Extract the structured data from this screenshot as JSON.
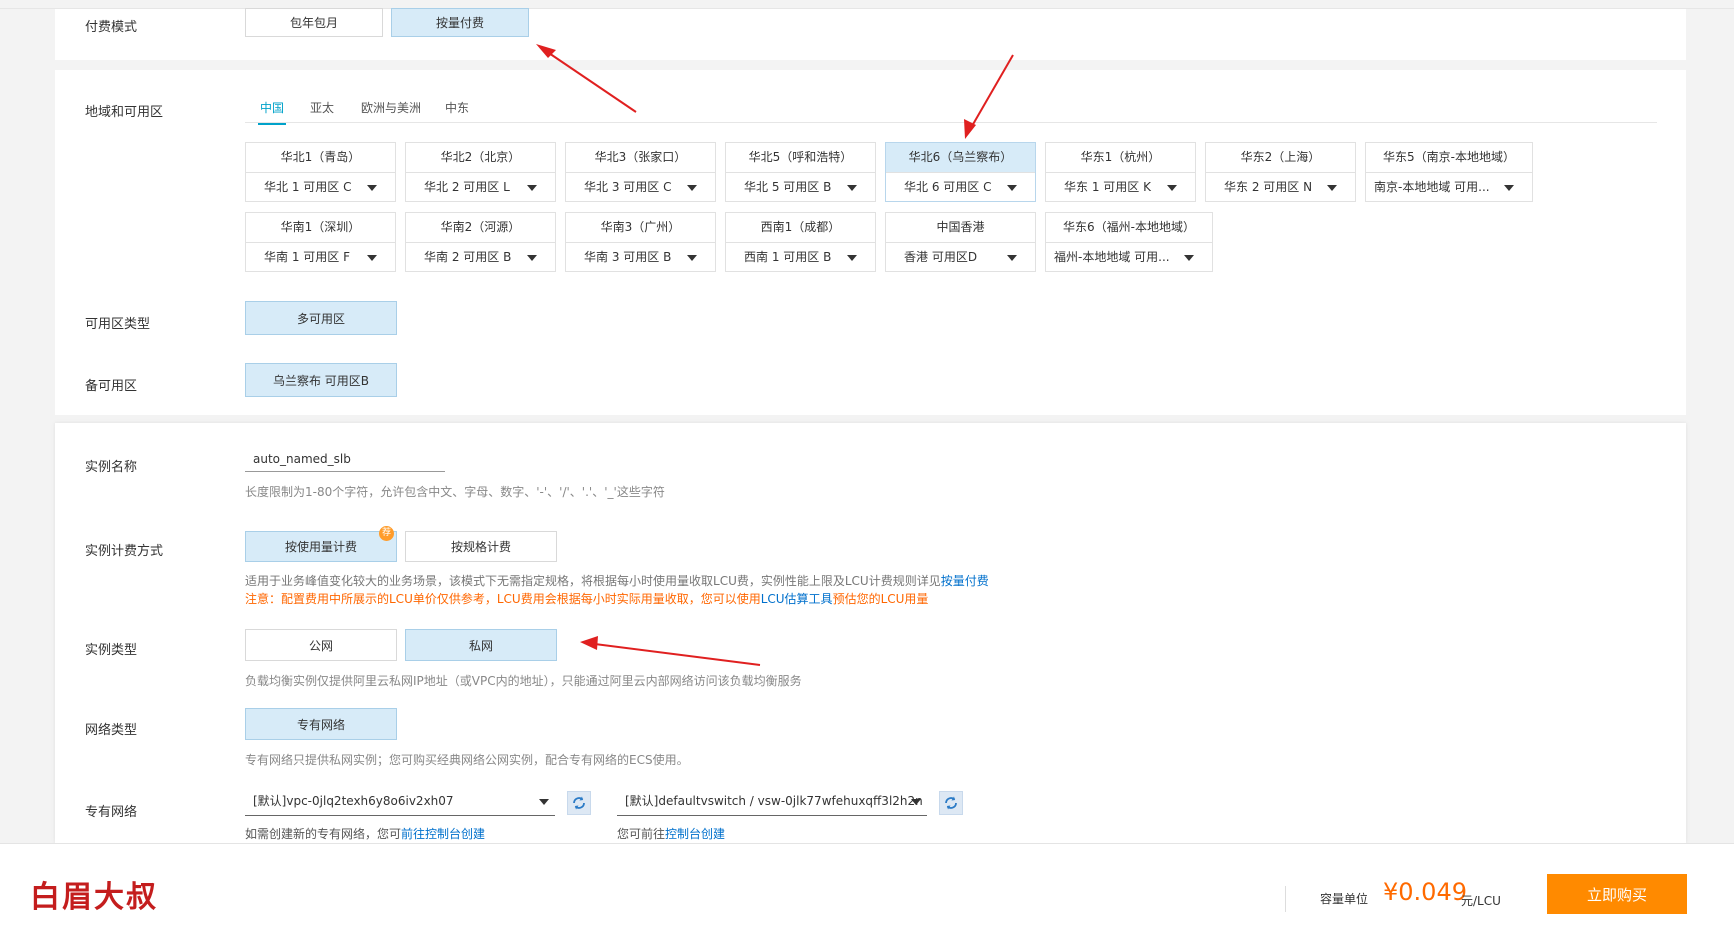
{
  "billing_mode": {
    "label": "付费模式",
    "options": [
      "包年包月",
      "按量付费"
    ],
    "selected": "按量付费"
  },
  "region": {
    "label": "地域和可用区",
    "tabs": [
      "中国",
      "亚太",
      "欧洲与美洲",
      "中东"
    ],
    "active_tab": "中国",
    "zones": [
      {
        "title": "华北1（青岛）",
        "zone": "华北 1 可用区 C"
      },
      {
        "title": "华北2（北京）",
        "zone": "华北 2 可用区 L"
      },
      {
        "title": "华北3（张家口）",
        "zone": "华北 3 可用区 C"
      },
      {
        "title": "华北5（呼和浩特）",
        "zone": "华北 5 可用区 B"
      },
      {
        "title": "华北6（乌兰察布）",
        "zone": "华北 6 可用区 C"
      },
      {
        "title": "华东1（杭州）",
        "zone": "华东 1 可用区 K"
      },
      {
        "title": "华东2（上海）",
        "zone": "华东 2 可用区 N"
      },
      {
        "title": "华东5（南京-本地地域）",
        "zone": "南京-本地地域 可用..."
      },
      {
        "title": "华南1（深圳）",
        "zone": "华南 1 可用区 F"
      },
      {
        "title": "华南2（河源）",
        "zone": "华南 2 可用区 B"
      },
      {
        "title": "华南3（广州）",
        "zone": "华南 3 可用区 B"
      },
      {
        "title": "西南1（成都）",
        "zone": "西南 1 可用区 B"
      },
      {
        "title": "中国香港",
        "zone": "香港 可用区D"
      },
      {
        "title": "华东6（福州-本地地域）",
        "zone": "福州-本地地域 可用..."
      }
    ],
    "selected_zone": "华北6（乌兰察布）"
  },
  "zone_type": {
    "label": "可用区类型",
    "value": "多可用区"
  },
  "backup_zone": {
    "label": "备可用区",
    "value": "乌兰察布 可用区B"
  },
  "instance_name": {
    "label": "实例名称",
    "value": "auto_named_slb",
    "hint": "长度限制为1-80个字符，允许包含中文、字母、数字、'-'、'/'、'.'、'_'这些字符"
  },
  "instance_billing": {
    "label": "实例计费方式",
    "options": [
      "按使用量计费",
      "按规格计费"
    ],
    "selected": "按使用量计费",
    "badge": "荐",
    "desc_prefix": "适用于业务峰值变化较大的业务场景，该模式下无需指定规格，将根据每小时使用量收取LCU费，实例性能上限及LCU计费规则详见",
    "desc_link": "按量付费",
    "warn_prefix": "注意：配置费用中所展示的LCU单价仅供参考，LCU费用会根据每小时实际用量收取，您可以使用",
    "warn_link": "LCU估算工具",
    "warn_suffix": "预估您的LCU用量"
  },
  "instance_type": {
    "label": "实例类型",
    "options": [
      "公网",
      "私网"
    ],
    "selected": "私网",
    "hint": "负载均衡实例仅提供阿里云私网IP地址（或VPC内的地址），只能通过阿里云内部网络访问该负载均衡服务"
  },
  "network_type": {
    "label": "网络类型",
    "value": "专有网络",
    "hint": "专有网络只提供私网实例；您可购买经典网络公网实例，配合专有网络的ECS使用。"
  },
  "vpc": {
    "label": "专有网络",
    "vpc_value": "[默认]vpc-0jlq2texh6y8o6iv2xh07",
    "vswitch_value": "[默认]defaultvswitch / vsw-0jlk77wfehuxqff3l2h2n",
    "vpc_hint_prefix": "如需创建新的专有网络，您可",
    "vpc_hint_link": "前往控制台创建",
    "vsw_hint_prefix": "您可前往",
    "vsw_hint_link": "控制台创建"
  },
  "footer": {
    "logo": "白眉大叔",
    "capacity_label": "容量单位",
    "price": "¥0.049",
    "price_unit": "元/LCU",
    "buy_label": "立即购买"
  },
  "colors": {
    "accent": "#00a2ca",
    "selected_bg": "#d7ebf8",
    "price": "#ff6a00",
    "buy": "#ff8a00",
    "arrow": "#e02020",
    "logo": "#c41d1d"
  }
}
